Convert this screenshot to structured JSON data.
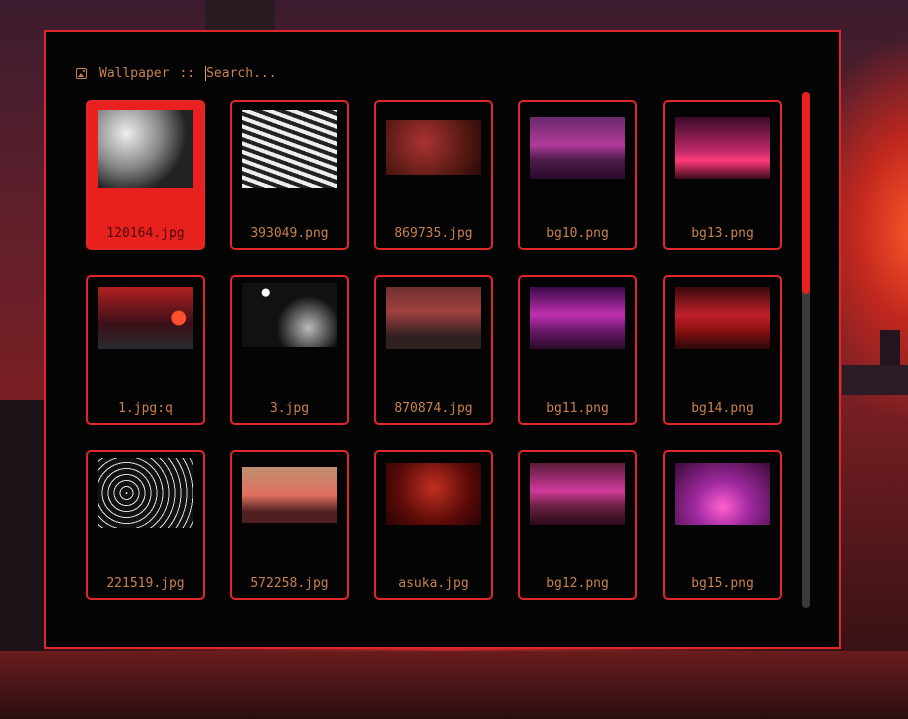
{
  "launcher": {
    "mode_label": "Wallpaper",
    "separator": "::",
    "search_placeholder": "Search...",
    "search_value": "",
    "icon": "image-icon"
  },
  "wallpapers": [
    {
      "name": "120164.jpg",
      "selected": true
    },
    {
      "name": "393049.png"
    },
    {
      "name": "869735.jpg"
    },
    {
      "name": "bg10.png"
    },
    {
      "name": "bg13.png"
    },
    {
      "name": "1.jpg:q"
    },
    {
      "name": "3.jpg"
    },
    {
      "name": "870874.jpg"
    },
    {
      "name": "bg11.png"
    },
    {
      "name": "bg14.png"
    },
    {
      "name": "221519.jpg"
    },
    {
      "name": "572258.jpg"
    },
    {
      "name": "asuka.jpg"
    },
    {
      "name": "bg12.png"
    },
    {
      "name": "bg15.png"
    }
  ],
  "scroll": {
    "position": 0,
    "visible_fraction": 0.39
  },
  "colors": {
    "accent": "#e0282a",
    "text": "#c8814e",
    "panel": "#040404"
  }
}
